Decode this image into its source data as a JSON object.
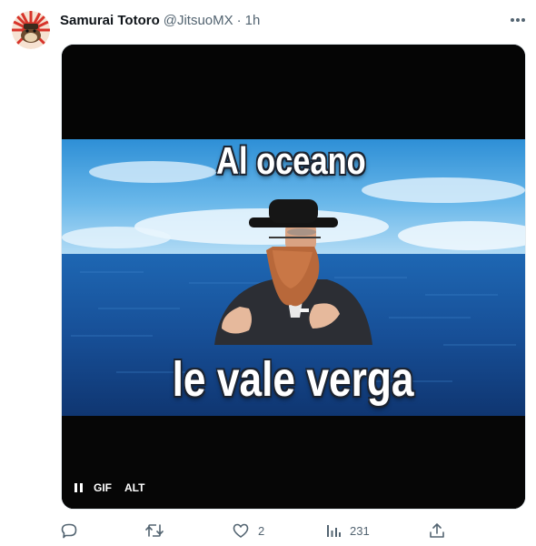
{
  "tweet": {
    "author_name": "Samurai Totoro",
    "handle": "@JitsuoMX",
    "separator": "·",
    "time": "1h"
  },
  "media": {
    "caption_top": "Al oceano",
    "caption_bottom": "le vale verga",
    "gif_badge": "GIF",
    "alt_badge": "ALT",
    "playback_state": "playing"
  },
  "actions": {
    "reply_count": "",
    "retweet_count": "",
    "like_count": "2",
    "views_count": "231"
  },
  "colors": {
    "text_primary": "#0f1419",
    "text_secondary": "#536471",
    "media_border": "#e6ecf0"
  },
  "icons": [
    "more-icon",
    "reply-icon",
    "retweet-icon",
    "like-icon",
    "views-icon",
    "share-icon",
    "pause-icon"
  ]
}
